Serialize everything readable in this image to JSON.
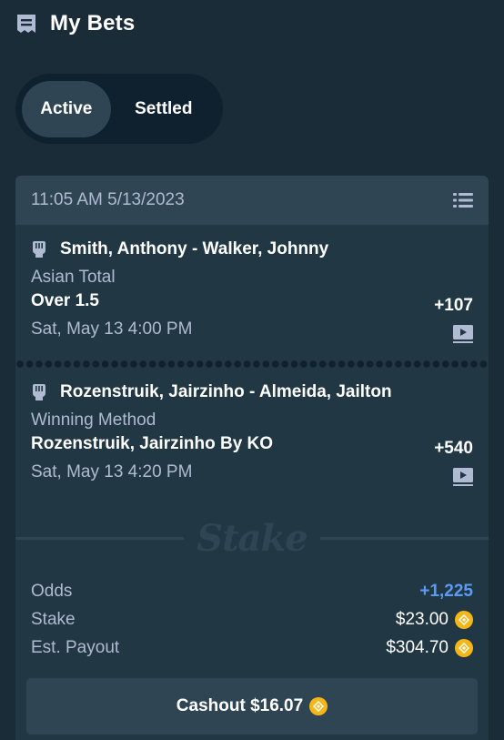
{
  "header": {
    "title": "My Bets",
    "icon": "receipt-icon"
  },
  "tabs": [
    {
      "label": "Active",
      "selected": true
    },
    {
      "label": "Settled",
      "selected": false
    }
  ],
  "bet": {
    "placed_at": "11:05 AM 5/13/2023",
    "legs": [
      {
        "match": "Smith, Anthony - Walker, Johnny",
        "market": "Asian Total",
        "selection": "Over 1.5",
        "odds": "+107",
        "start_time": "Sat, May 13 4:00 PM"
      },
      {
        "match": "Rozenstruik, Jairzinho - Almeida, Jailton",
        "market": "Winning Method",
        "selection": "Rozenstruik, Jairzinho By KO",
        "odds": "+540",
        "start_time": "Sat, May 13 4:20 PM"
      }
    ],
    "watermark": "Stake",
    "summary": {
      "odds_label": "Odds",
      "odds_value": "+1,225",
      "stake_label": "Stake",
      "stake_value": "$23.00",
      "payout_label": "Est. Payout",
      "payout_value": "$304.70"
    },
    "cashout_label": "Cashout $16.07"
  },
  "colors": {
    "background": "#1a2c38",
    "card": "#213743",
    "card_header": "#2f4553",
    "muted_text": "#b1bad3",
    "odds_blue": "#5b9bf3",
    "coin": "#f3b717"
  }
}
